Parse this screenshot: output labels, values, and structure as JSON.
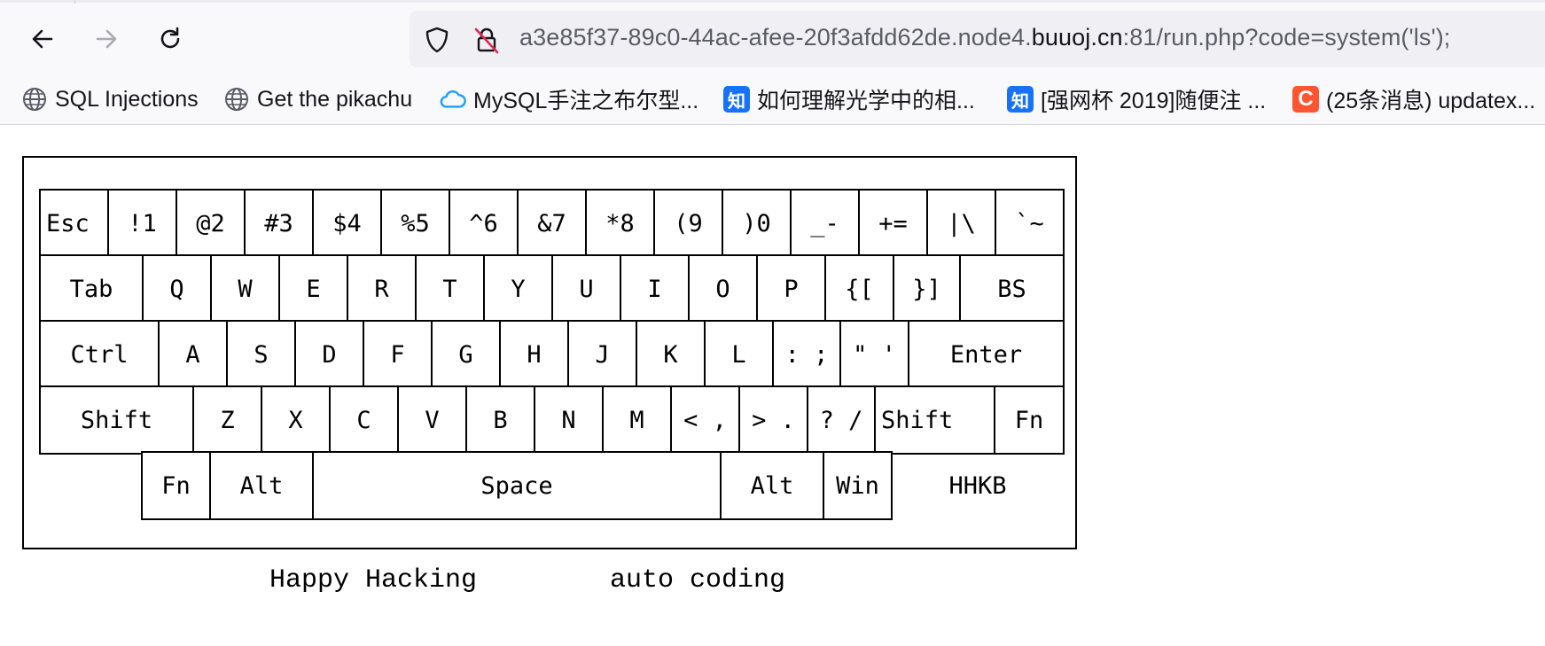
{
  "browser": {
    "url_prefix": "a3e85f37-89c0-44ac-afee-20f3afdd62de.node4.",
    "url_host": "buuoj.cn",
    "url_suffix": ":81/run.php?code=system('ls');"
  },
  "bookmarks": [
    {
      "label": "SQL Injections",
      "icon": "globe-icon"
    },
    {
      "label": "Get the pikachu",
      "icon": "globe-icon"
    },
    {
      "label": "MySQL手注之布尔型...",
      "icon": "cloud-icon"
    },
    {
      "label": "如何理解光学中的相...",
      "icon": "zhihu-icon",
      "icon_text": "知"
    },
    {
      "label": "[强网杯 2019]随便注 ...",
      "icon": "zhihu-icon",
      "icon_text": "知"
    },
    {
      "label": "(25条消息) updatex...",
      "icon": "csdn-icon",
      "icon_text": "C"
    }
  ],
  "keyboard": {
    "rows": [
      [
        "Esc",
        "!1",
        "@2",
        "#3",
        "$4",
        "%5",
        "^6",
        "&7",
        "*8",
        "(9",
        ")0",
        "_-",
        "+=",
        "|\\",
        "`~"
      ],
      [
        "Tab",
        "Q",
        "W",
        "E",
        "R",
        "T",
        "Y",
        "U",
        "I",
        "O",
        "P",
        "{[",
        "}]",
        "BS"
      ],
      [
        "Ctrl",
        "A",
        "S",
        "D",
        "F",
        "G",
        "H",
        "J",
        "K",
        "L",
        ": ;",
        "\" '",
        "Enter"
      ],
      [
        "Shift",
        "Z",
        "X",
        "C",
        "V",
        "B",
        "N",
        "M",
        "< ,",
        "> .",
        "? /",
        "Shift",
        "Fn"
      ],
      [
        "Fn",
        "Alt",
        "Space",
        "Alt",
        "Win"
      ]
    ],
    "brand": "HHKB",
    "caption_left": "Happy Hacking",
    "caption_right": "auto coding"
  },
  "colors": {
    "toolbar_bg": "#f9f9fb",
    "urlbar_bg": "#f0f0f4",
    "zhihu": "#1772f6",
    "csdn": "#fc5531",
    "cloud": "#1e9fff"
  }
}
